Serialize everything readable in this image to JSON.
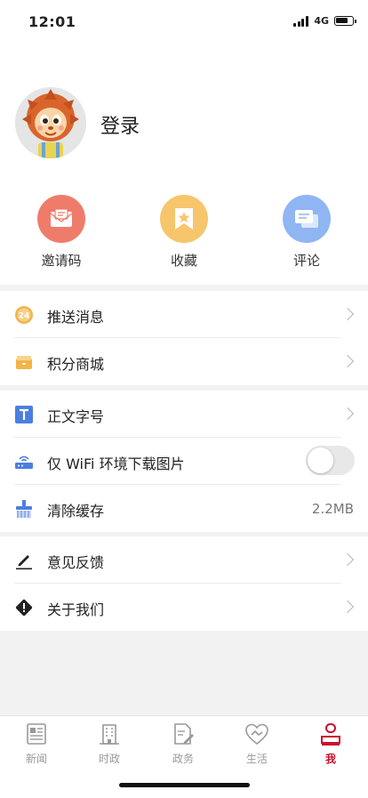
{
  "status_bar": {
    "time": "12:01",
    "network": "4G"
  },
  "profile": {
    "login_label": "登录"
  },
  "quick_actions": [
    {
      "label": "邀请码",
      "icon": "envelope-icon",
      "color": "#ef7c6a"
    },
    {
      "label": "收藏",
      "icon": "bookmark-star-icon",
      "color": "#f7c56b"
    },
    {
      "label": "评论",
      "icon": "comment-icon",
      "color": "#8fb5f3"
    }
  ],
  "menu_group_1": [
    {
      "label": "推送消息",
      "icon": "push-24-icon"
    },
    {
      "label": "积分商城",
      "icon": "points-mall-icon"
    }
  ],
  "menu_group_2": {
    "font_size": {
      "label": "正文字号",
      "icon": "text-size-icon"
    },
    "wifi_only": {
      "label": "仅 WiFi 环境下载图片",
      "icon": "wifi-router-icon",
      "enabled": false
    },
    "clear_cache": {
      "label": "清除缓存",
      "value": "2.2MB",
      "icon": "broom-icon"
    }
  },
  "menu_group_3": [
    {
      "label": "意见反馈",
      "icon": "pencil-icon"
    },
    {
      "label": "关于我们",
      "icon": "info-diamond-icon"
    }
  ],
  "tab_bar": [
    {
      "label": "新闻",
      "icon": "newspaper-icon",
      "active": false
    },
    {
      "label": "时政",
      "icon": "building-icon",
      "active": false
    },
    {
      "label": "政务",
      "icon": "document-pen-icon",
      "active": false
    },
    {
      "label": "生活",
      "icon": "handshake-heart-icon",
      "active": false
    },
    {
      "label": "我",
      "icon": "person-icon",
      "active": true
    }
  ],
  "colors": {
    "accent": "#c8102e",
    "tab_inactive": "#999999",
    "toggle_off": "#e8e8e8"
  }
}
